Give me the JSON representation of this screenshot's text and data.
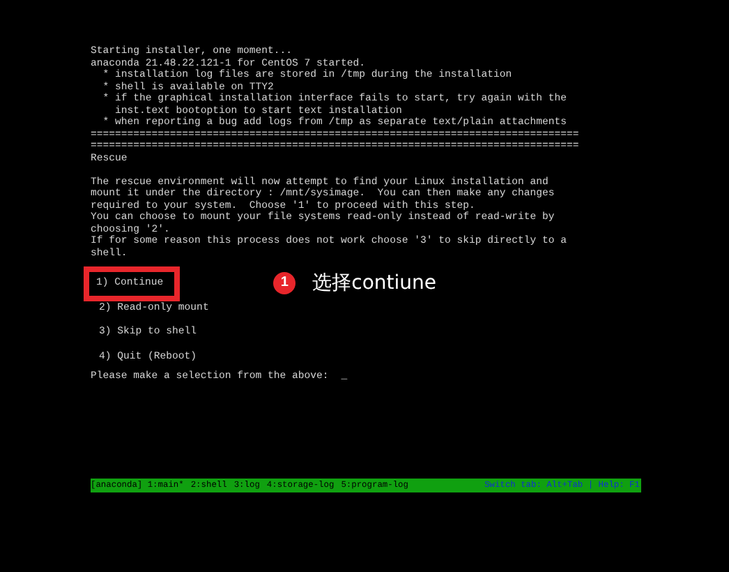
{
  "console_blocks": [
    [
      "Starting installer, one moment...",
      "anaconda 21.48.22.121-1 for CentOS 7 started.",
      "  * installation log files are stored in /tmp during the installation",
      "  * shell is available on TTY2",
      "  * if the graphical installation interface fails to start, try again with the",
      "    inst.text bootoption to start text installation",
      "  * when reporting a bug add logs from /tmp as separate text/plain attachments",
      "================================================================================",
      "================================================================================",
      "Rescue"
    ],
    [
      "The rescue environment will now attempt to find your Linux installation and",
      "mount it under the directory : /mnt/sysimage.  You can then make any changes",
      "required to your system.  Choose '1' to proceed with this step.",
      "You can choose to mount your file systems read-only instead of read-write by",
      "choosing '2'.",
      "If for some reason this process does not work choose '3' to skip directly to a",
      "shell."
    ]
  ],
  "options": [
    {
      "label": "1) Continue",
      "highlighted": true
    },
    {
      "label": "2) Read-only mount",
      "highlighted": false
    },
    {
      "label": "3) Skip to shell",
      "highlighted": false
    },
    {
      "label": "4) Quit (Reboot)",
      "highlighted": false
    }
  ],
  "annotation": {
    "number": "1",
    "text": "选择contiune"
  },
  "prompt": "Please make a selection from the above:",
  "cursor": "_",
  "status_bar": {
    "tabs": [
      "[anaconda] 1:main*",
      "2:shell",
      "3:log",
      "4:storage-log",
      "5:program-log"
    ],
    "hint": "Switch tab: Alt+Tab | Help: F1"
  }
}
